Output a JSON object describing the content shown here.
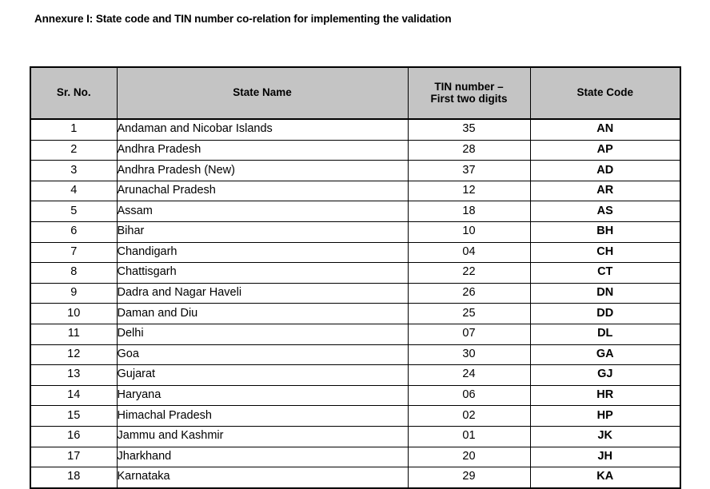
{
  "document": {
    "title": "Annexure I: State code and TIN number co-relation for implementing the validation"
  },
  "table": {
    "headers": {
      "sr_no": "Sr. No.",
      "state_name": "State Name",
      "tin_line1": "TIN number –",
      "tin_line2": "First two digits",
      "state_code": "State Code"
    },
    "rows": [
      {
        "sr_no": "1",
        "state_name": "Andaman and Nicobar Islands",
        "tin": "35",
        "state_code": "AN"
      },
      {
        "sr_no": "2",
        "state_name": "Andhra Pradesh",
        "tin": "28",
        "state_code": "AP"
      },
      {
        "sr_no": "3",
        "state_name": "Andhra Pradesh (New)",
        "tin": "37",
        "state_code": "AD"
      },
      {
        "sr_no": "4",
        "state_name": "Arunachal Pradesh",
        "tin": "12",
        "state_code": "AR"
      },
      {
        "sr_no": "5",
        "state_name": "Assam",
        "tin": "18",
        "state_code": "AS"
      },
      {
        "sr_no": "6",
        "state_name": "Bihar",
        "tin": "10",
        "state_code": "BH"
      },
      {
        "sr_no": "7",
        "state_name": "Chandigarh",
        "tin": "04",
        "state_code": "CH"
      },
      {
        "sr_no": "8",
        "state_name": "Chattisgarh",
        "tin": "22",
        "state_code": "CT"
      },
      {
        "sr_no": "9",
        "state_name": "Dadra and Nagar Haveli",
        "tin": "26",
        "state_code": "DN"
      },
      {
        "sr_no": "10",
        "state_name": "Daman and Diu",
        "tin": "25",
        "state_code": "DD"
      },
      {
        "sr_no": "11",
        "state_name": "Delhi",
        "tin": "07",
        "state_code": "DL"
      },
      {
        "sr_no": "12",
        "state_name": "Goa",
        "tin": "30",
        "state_code": "GA"
      },
      {
        "sr_no": "13",
        "state_name": "Gujarat",
        "tin": "24",
        "state_code": "GJ"
      },
      {
        "sr_no": "14",
        "state_name": "Haryana",
        "tin": "06",
        "state_code": "HR"
      },
      {
        "sr_no": "15",
        "state_name": "Himachal Pradesh",
        "tin": "02",
        "state_code": "HP"
      },
      {
        "sr_no": "16",
        "state_name": "Jammu and Kashmir",
        "tin": "01",
        "state_code": "JK"
      },
      {
        "sr_no": "17",
        "state_name": "Jharkhand",
        "tin": "20",
        "state_code": "JH"
      },
      {
        "sr_no": "18",
        "state_name": "Karnataka",
        "tin": "29",
        "state_code": "KA"
      }
    ]
  },
  "colors": {
    "header_background": "#c4c4c4",
    "border": "#000000",
    "text": "#000000",
    "page_background": "#ffffff"
  }
}
